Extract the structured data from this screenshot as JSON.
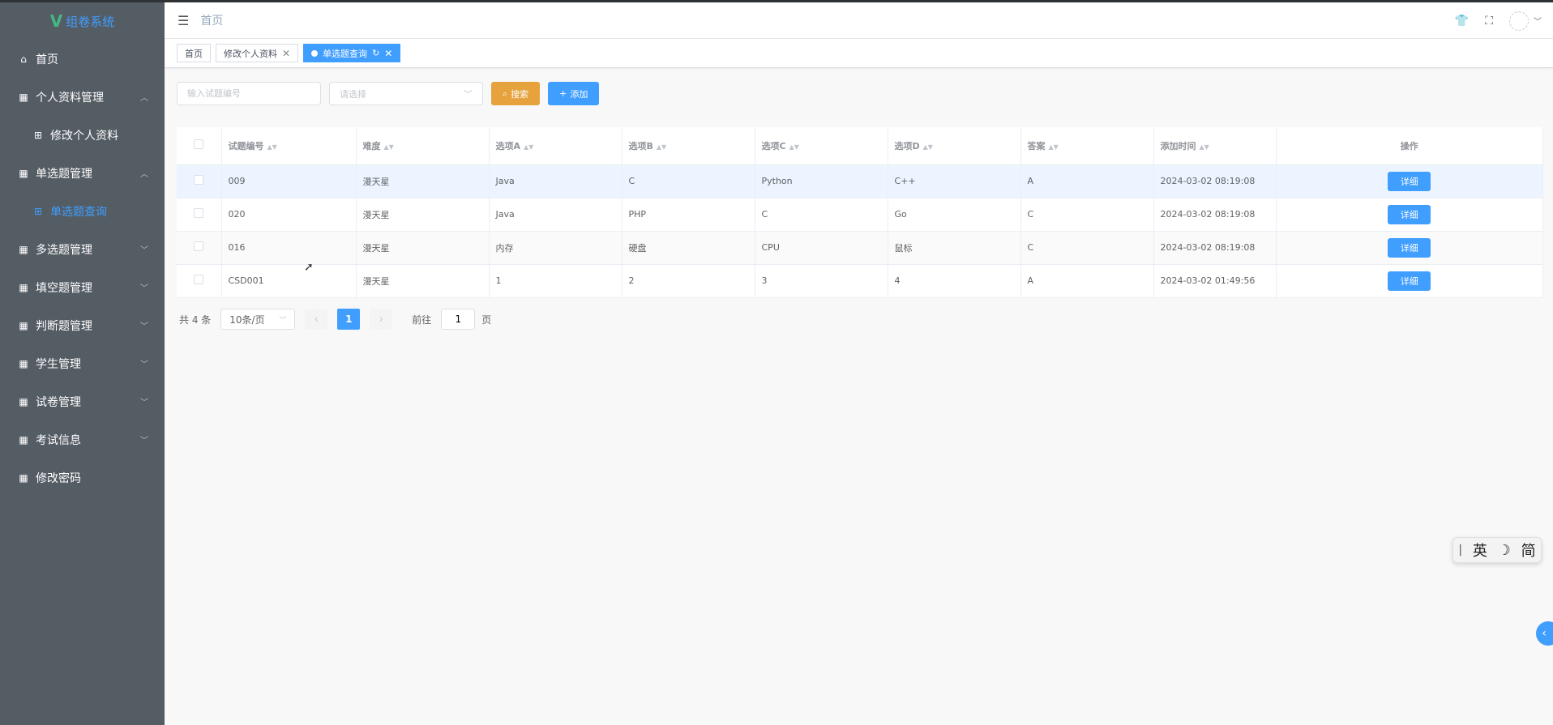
{
  "sidebar": {
    "logo_mark": "V",
    "logo_text": "组卷系统",
    "items": [
      {
        "label": "首页",
        "icon": "home-icon"
      },
      {
        "label": "个人资料管理",
        "icon": "grid-icon",
        "expanded": true
      },
      {
        "label": "修改个人资料",
        "icon": "apps-icon"
      },
      {
        "label": "单选题管理",
        "icon": "grid-icon",
        "expanded": true
      },
      {
        "label": "单选题查询",
        "icon": "apps-icon",
        "active": true
      },
      {
        "label": "多选题管理",
        "icon": "grid-icon"
      },
      {
        "label": "填空题管理",
        "icon": "grid-icon"
      },
      {
        "label": "判断题管理",
        "icon": "grid-icon"
      },
      {
        "label": "学生管理",
        "icon": "grid-icon"
      },
      {
        "label": "试卷管理",
        "icon": "grid-icon"
      },
      {
        "label": "考试信息",
        "icon": "grid-icon"
      },
      {
        "label": "修改密码",
        "icon": "grid-icon"
      }
    ]
  },
  "header": {
    "breadcrumb": "首页"
  },
  "tags": [
    {
      "label": "首页"
    },
    {
      "label": "修改个人资料"
    },
    {
      "label": "单选题查询",
      "active": true
    }
  ],
  "toolbar": {
    "search_placeholder": "输入试题编号",
    "select_placeholder": "请选择",
    "search_label": "搜索",
    "add_label": "添加"
  },
  "table": {
    "columns": [
      "试题编号",
      "难度",
      "选项A",
      "选项B",
      "选项C",
      "选项D",
      "答案",
      "添加时间",
      "操作"
    ],
    "rows": [
      [
        "009",
        "漫天星",
        "Java",
        "C",
        "Python",
        "C++",
        "A",
        "2024-03-02 08:19:08"
      ],
      [
        "020",
        "漫天星",
        "Java",
        "PHP",
        "C",
        "Go",
        "C",
        "2024-03-02 08:19:08"
      ],
      [
        "016",
        "漫天星",
        "内存",
        "硬盘",
        "CPU",
        "鼠标",
        "C",
        "2024-03-02 08:19:08"
      ],
      [
        "CSD001",
        "漫天星",
        "1",
        "2",
        "3",
        "4",
        "A",
        "2024-03-02 01:49:56"
      ]
    ],
    "action_label": "详细"
  },
  "pagination": {
    "total_text": "共 4 条",
    "page_size": "10条/页",
    "current_page": "1",
    "goto_label": "前往",
    "goto_value": "1",
    "page_suffix": "页"
  },
  "ime": {
    "lang": "英",
    "mode": "简"
  },
  "colors": {
    "sidebar_bg": "#545c64",
    "primary": "#409eff",
    "warning": "#e6a23c"
  }
}
